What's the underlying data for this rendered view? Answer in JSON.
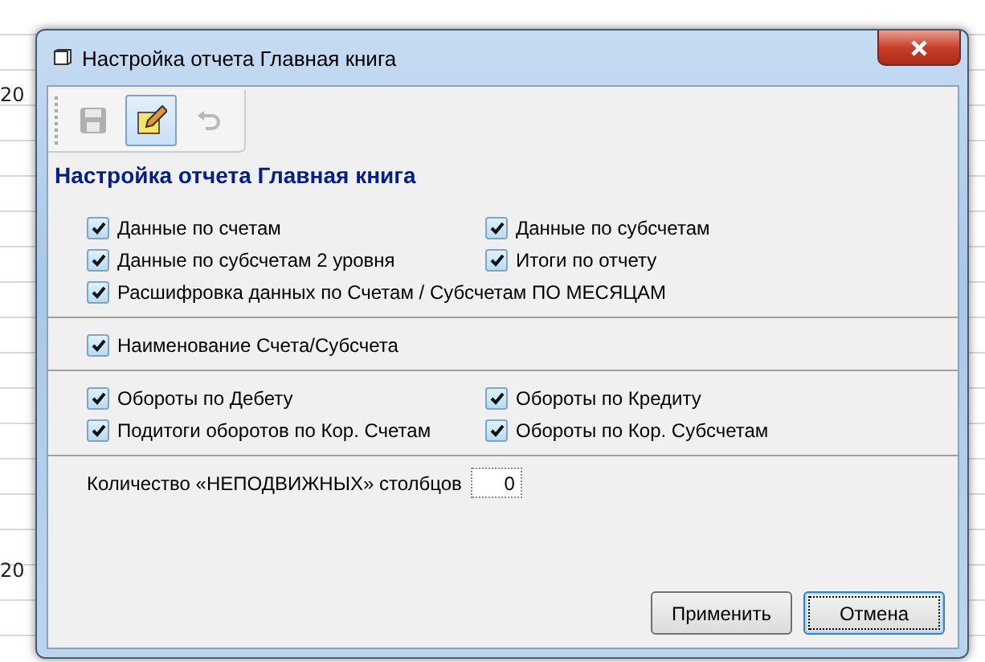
{
  "background": {
    "row_labels": [
      "20",
      "20"
    ]
  },
  "dialog": {
    "title": "Настройка отчета Главная книга",
    "toolbar": [
      {
        "kind": "save",
        "disabled": true,
        "selected": false
      },
      {
        "kind": "edit",
        "disabled": false,
        "selected": true
      },
      {
        "kind": "undo",
        "disabled": true,
        "selected": false
      }
    ],
    "heading": "Настройка отчета Главная книга",
    "groups": [
      {
        "rows": [
          [
            {
              "label": "Данные по счетам",
              "checked": true
            },
            {
              "label": "Данные по субсчетам",
              "checked": true
            }
          ],
          [
            {
              "label": "Данные по субсчетам 2 уровня",
              "checked": true
            },
            {
              "label": "Итоги по отчету",
              "checked": true
            }
          ],
          [
            {
              "label": "Расшифровка данных по Счетам / Субсчетам ПО МЕСЯЦАМ",
              "checked": true
            }
          ]
        ]
      },
      {
        "rows": [
          [
            {
              "label": "Наименование Счета/Субсчета",
              "checked": true
            }
          ]
        ]
      },
      {
        "rows": [
          [
            {
              "label": "Обороты по Дебету",
              "checked": true
            },
            {
              "label": "Обороты по Кредиту",
              "checked": true
            }
          ],
          [
            {
              "label": "Подитоги оборотов по Кор. Счетам",
              "checked": true
            },
            {
              "label": "Обороты по Кор. Субсчетам",
              "checked": true
            }
          ]
        ]
      }
    ],
    "fixed_columns": {
      "label": "Количество «НЕПОДВИЖНЫХ» столбцов",
      "value": "0"
    },
    "buttons": [
      {
        "label": "Применить",
        "default": false
      },
      {
        "label": "Отмена",
        "default": true
      }
    ]
  }
}
